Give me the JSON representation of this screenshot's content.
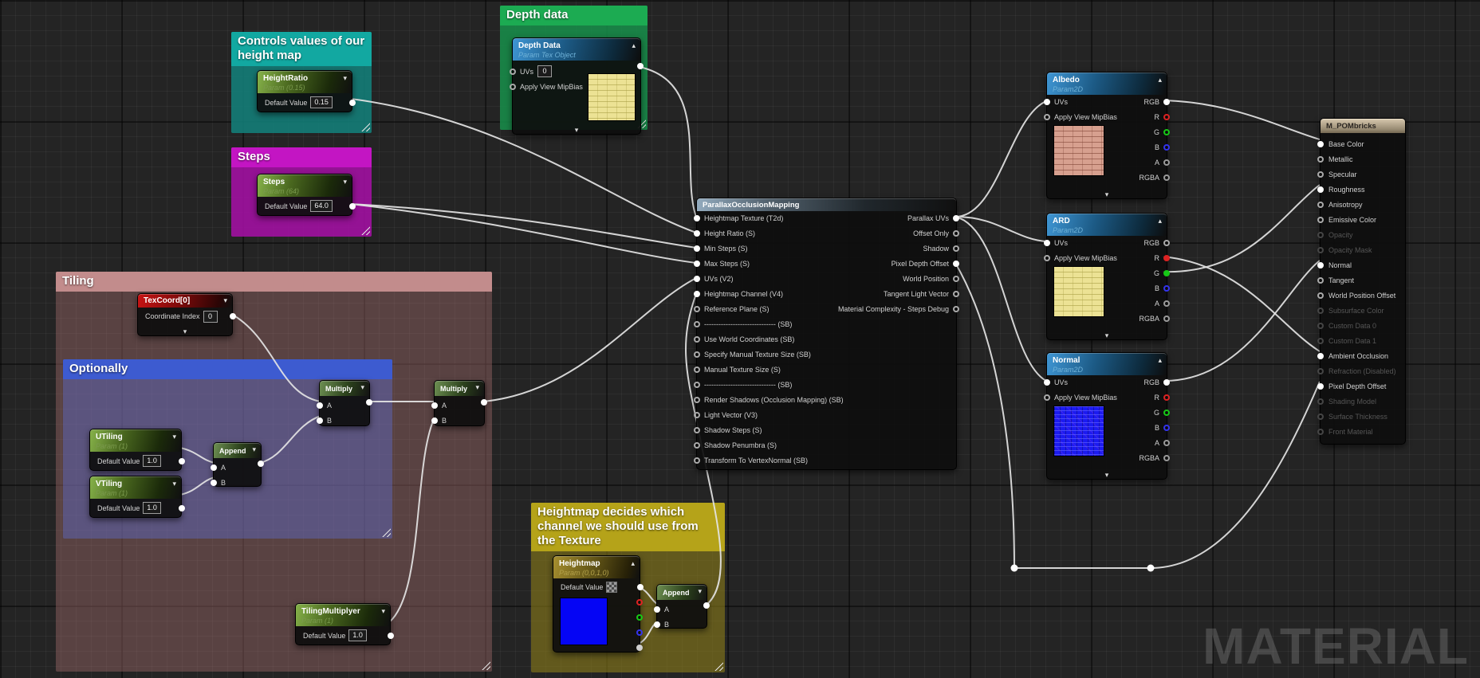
{
  "watermark": "MATERIAL",
  "colors": {
    "comment_teal": "#12A8A1",
    "comment_magenta": "#C315C3",
    "comment_green": "#1CAB52",
    "comment_rose": "#C28C8C",
    "comment_blue": "#3D5BD0",
    "comment_olive": "#B5A319",
    "wire": "#E4E4E4"
  },
  "comments": {
    "height_map": {
      "title": "Controls values of our height map"
    },
    "steps": {
      "title": "Steps"
    },
    "depth_data": {
      "title": "Depth data"
    },
    "tiling": {
      "title": "Tiling"
    },
    "optionally": {
      "title": "Optionally"
    },
    "heightmap": {
      "title": "Heightmap decides which channel we should use from the Texture"
    }
  },
  "nodes": {
    "height_ratio": {
      "title": "HeightRatio",
      "subtitle": "Param (0.15)",
      "default_label": "Default Value",
      "value": "0.15"
    },
    "steps": {
      "title": "Steps",
      "subtitle": "Param (64)",
      "default_label": "Default Value",
      "value": "64.0"
    },
    "depth_data": {
      "title": "Depth Data",
      "subtitle": "Param Tex Object",
      "uvs_label": "UVs",
      "uvs_value": "0",
      "mip_label": "Apply View MipBias"
    },
    "texcoord": {
      "title": "TexCoord[0]",
      "index_label": "Coordinate Index",
      "index_value": "0"
    },
    "utiling": {
      "title": "UTiling",
      "subtitle": "Param (1)",
      "default_label": "Default Value",
      "value": "1.0"
    },
    "vtiling": {
      "title": "VTiling",
      "subtitle": "Param (1)",
      "default_label": "Default Value",
      "value": "1.0"
    },
    "tiling_multiplyer": {
      "title": "TilingMultiplyer",
      "subtitle": "Param (1)",
      "default_label": "Default Value",
      "value": "1.0"
    },
    "append1": {
      "title": "Append",
      "a": "A",
      "b": "B"
    },
    "append2": {
      "title": "Append",
      "a": "A",
      "b": "B"
    },
    "multiply1": {
      "title": "Multiply",
      "a": "A",
      "b": "B"
    },
    "multiply2": {
      "title": "Multiply",
      "a": "A",
      "b": "B"
    },
    "heightmap": {
      "title": "Heightmap",
      "subtitle": "Param (0,0,1,0)",
      "default_label": "Default Value",
      "channel_pins": [
        {
          "color": "red",
          "state": "open"
        },
        {
          "color": "green",
          "state": "open"
        },
        {
          "color": "blue",
          "state": "open"
        },
        {
          "color": "gray",
          "state": "connected"
        }
      ]
    },
    "pom": {
      "title": "ParallaxOcclusionMapping",
      "inputs": [
        {
          "label": "Heightmap Texture (T2d)",
          "state": "connected"
        },
        {
          "label": "Height Ratio (S)",
          "state": "connected"
        },
        {
          "label": "Min Steps (S)",
          "state": "connected"
        },
        {
          "label": "Max Steps (S)",
          "state": "connected"
        },
        {
          "label": "UVs (V2)",
          "state": "connected"
        },
        {
          "label": "Heightmap Channel (V4)",
          "state": "connected"
        },
        {
          "label": "Reference Plane (S)",
          "state": "open"
        },
        {
          "label": "------------------------------ (SB)",
          "state": "open"
        },
        {
          "label": "Use World Coordinates (SB)",
          "state": "open"
        },
        {
          "label": "Specify Manual Texture Size (SB)",
          "state": "open"
        },
        {
          "label": "Manual Texture Size (S)",
          "state": "open"
        },
        {
          "label": "------------------------------ (SB)",
          "state": "open"
        },
        {
          "label": "Render Shadows (Occlusion Mapping) (SB)",
          "state": "open"
        },
        {
          "label": "Light Vector (V3)",
          "state": "open"
        },
        {
          "label": "Shadow Steps (S)",
          "state": "open"
        },
        {
          "label": "Shadow Penumbra (S)",
          "state": "open"
        },
        {
          "label": "Transform To VertexNormal (SB)",
          "state": "open"
        }
      ],
      "outputs": [
        {
          "label": "Parallax UVs",
          "state": "connected"
        },
        {
          "label": "Offset Only",
          "state": "open"
        },
        {
          "label": "Shadow",
          "state": "open"
        },
        {
          "label": "Pixel Depth Offset",
          "state": "connected"
        },
        {
          "label": "World Position",
          "state": "open"
        },
        {
          "label": "Tangent Light Vector",
          "state": "open"
        },
        {
          "label": "Material Complexity - Steps Debug",
          "state": "open"
        }
      ]
    },
    "albedo": {
      "title": "Albedo",
      "subtitle": "Param2D",
      "uvs_label": "UVs",
      "mip_label": "Apply View MipBias",
      "outputs": [
        {
          "label": "RGB",
          "color": "white",
          "state": "connected"
        },
        {
          "label": "R",
          "color": "red",
          "state": "open"
        },
        {
          "label": "G",
          "color": "green",
          "state": "open"
        },
        {
          "label": "B",
          "color": "blue",
          "state": "open"
        },
        {
          "label": "A",
          "color": "gray",
          "state": "open"
        },
        {
          "label": "RGBA",
          "color": "gray",
          "state": "open"
        }
      ]
    },
    "ard": {
      "title": "ARD",
      "subtitle": "Param2D",
      "uvs_label": "UVs",
      "mip_label": "Apply View MipBias",
      "outputs": [
        {
          "label": "RGB",
          "color": "white",
          "state": "open"
        },
        {
          "label": "R",
          "color": "red",
          "state": "connected"
        },
        {
          "label": "G",
          "color": "green",
          "state": "connected"
        },
        {
          "label": "B",
          "color": "blue",
          "state": "open"
        },
        {
          "label": "A",
          "color": "gray",
          "state": "open"
        },
        {
          "label": "RGBA",
          "color": "gray",
          "state": "open"
        }
      ]
    },
    "normal": {
      "title": "Normal",
      "subtitle": "Param2D",
      "uvs_label": "UVs",
      "mip_label": "Apply View MipBias",
      "outputs": [
        {
          "label": "RGB",
          "color": "white",
          "state": "connected"
        },
        {
          "label": "R",
          "color": "red",
          "state": "open"
        },
        {
          "label": "G",
          "color": "green",
          "state": "open"
        },
        {
          "label": "B",
          "color": "blue",
          "state": "open"
        },
        {
          "label": "A",
          "color": "gray",
          "state": "open"
        },
        {
          "label": "RGBA",
          "color": "gray",
          "state": "open"
        }
      ]
    },
    "material": {
      "title": "M_POMbricks",
      "pins": [
        {
          "label": "Base Color",
          "state": "connected"
        },
        {
          "label": "Metallic",
          "state": "open"
        },
        {
          "label": "Specular",
          "state": "open"
        },
        {
          "label": "Roughness",
          "state": "connected"
        },
        {
          "label": "Anisotropy",
          "state": "open"
        },
        {
          "label": "Emissive Color",
          "state": "open"
        },
        {
          "label": "Opacity",
          "state": "disabled"
        },
        {
          "label": "Opacity Mask",
          "state": "disabled"
        },
        {
          "label": "Normal",
          "state": "connected"
        },
        {
          "label": "Tangent",
          "state": "open"
        },
        {
          "label": "World Position Offset",
          "state": "open"
        },
        {
          "label": "Subsurface Color",
          "state": "disabled"
        },
        {
          "label": "Custom Data 0",
          "state": "disabled"
        },
        {
          "label": "Custom Data 1",
          "state": "disabled"
        },
        {
          "label": "Ambient Occlusion",
          "state": "connected"
        },
        {
          "label": "Refraction (Disabled)",
          "state": "disabled"
        },
        {
          "label": "Pixel Depth Offset",
          "state": "connected"
        },
        {
          "label": "Shading Model",
          "state": "disabled"
        },
        {
          "label": "Surface Thickness",
          "state": "disabled"
        },
        {
          "label": "Front Material",
          "state": "disabled"
        }
      ]
    }
  }
}
